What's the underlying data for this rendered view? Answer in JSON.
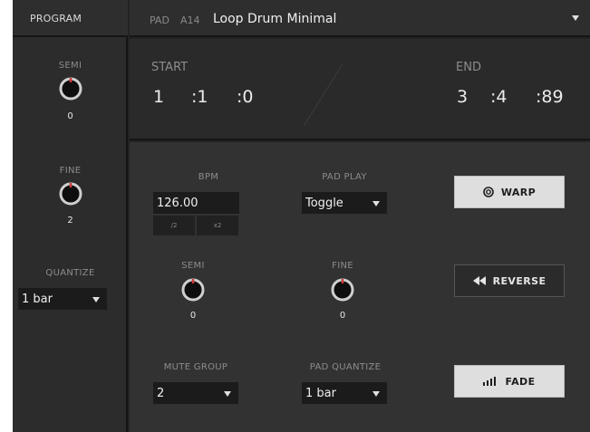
{
  "program": {
    "header": "PROGRAM",
    "semi": {
      "label": "SEMI",
      "value": "0"
    },
    "fine": {
      "label": "FINE",
      "value": "2"
    },
    "quantize": {
      "label": "QUANTIZE",
      "value": "1 bar"
    }
  },
  "topbar": {
    "pad_label": "PAD",
    "pad_id": "A14",
    "pad_name": "Loop Drum Minimal"
  },
  "range": {
    "start_label": "START",
    "start_bars": "1",
    "start_beats": ":1",
    "start_ticks": ":0",
    "end_label": "END",
    "end_bars": "3",
    "end_beats": ":4",
    "end_ticks": ":89"
  },
  "pad": {
    "bpm": {
      "label": "BPM",
      "value": "126.00",
      "half_label": "/2",
      "double_label": "x2"
    },
    "pad_play": {
      "label": "PAD PLAY",
      "value": "Toggle"
    },
    "semi": {
      "label": "SEMI",
      "value": "0"
    },
    "fine": {
      "label": "FINE",
      "value": "0"
    },
    "mute_group": {
      "label": "MUTE GROUP",
      "value": "2"
    },
    "pad_quantize": {
      "label": "PAD QUANTIZE",
      "value": "1 bar"
    }
  },
  "buttons": {
    "warp": "WARP",
    "reverse": "REVERSE",
    "fade": "FADE"
  },
  "colors": {
    "knob_indicator": "#d23a3a",
    "panel": "#323232"
  }
}
